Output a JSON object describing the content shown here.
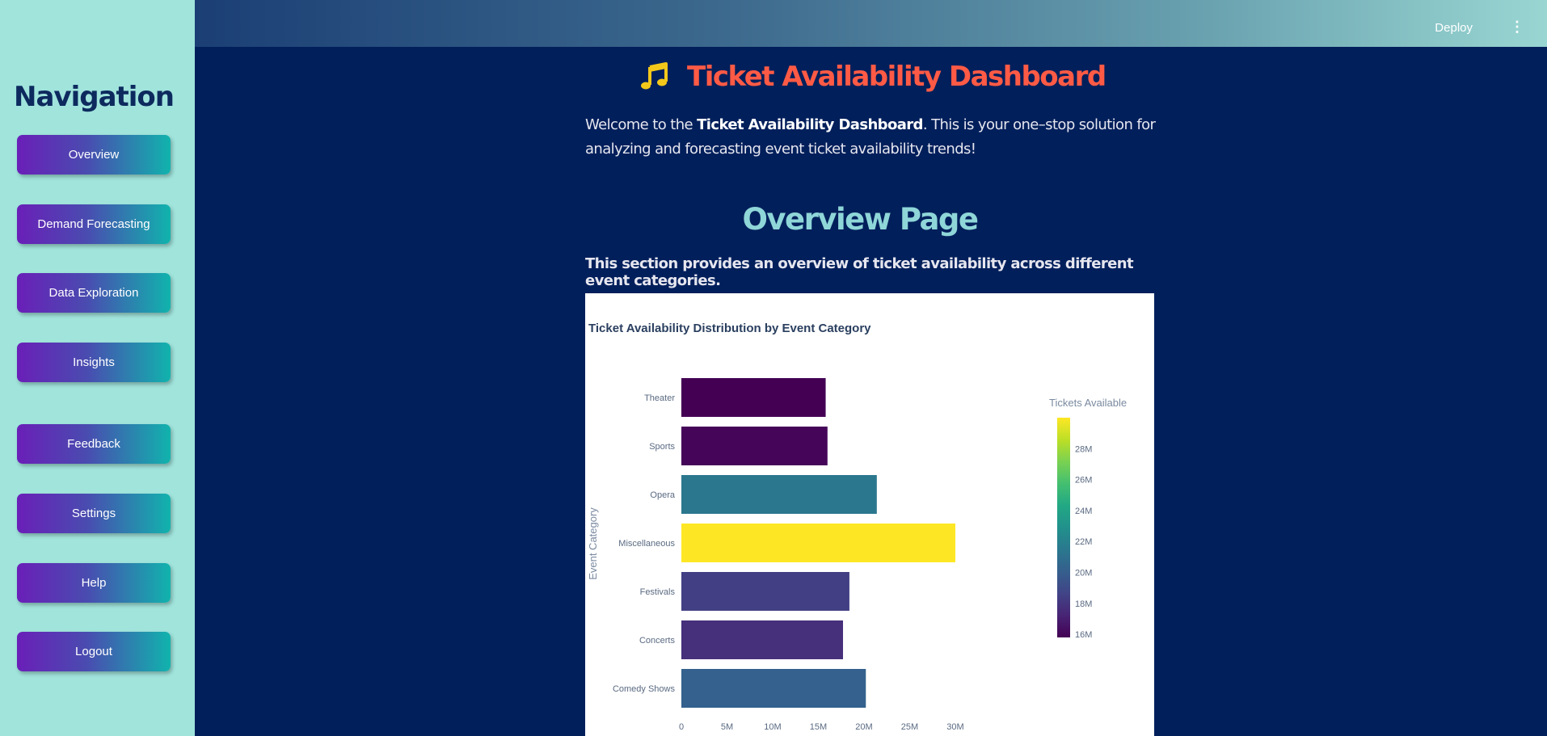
{
  "sidebar": {
    "title": "Navigation",
    "items": [
      {
        "label": "Overview",
        "name": "overview"
      },
      {
        "label": "Demand Forecasting",
        "name": "demand-forecasting"
      },
      {
        "label": "Data Exploration",
        "name": "data-exploration"
      },
      {
        "label": "Insights",
        "name": "insights"
      },
      {
        "label": "Feedback",
        "name": "feedback"
      },
      {
        "label": "Settings",
        "name": "settings"
      },
      {
        "label": "Help",
        "name": "help"
      },
      {
        "label": "Logout",
        "name": "logout"
      }
    ]
  },
  "header": {
    "deploy_label": "Deploy",
    "menu_icon": "kebab-menu-icon"
  },
  "main": {
    "title_icon": "music-note-icon",
    "title": "Ticket Availability Dashboard",
    "welcome_prefix": "Welcome to the ",
    "welcome_bold": "Ticket Availability Dashboard",
    "welcome_suffix": ". This is your one–stop solution for analyzing and forecasting event ticket availability trends!",
    "page_heading": "Overview Page",
    "section_description": "This section provides an overview of ticket availability across different event categories."
  },
  "colors": {
    "title": "#ff5a45",
    "heading": "#8fd6d8",
    "background": "#011f5b",
    "sidebar": "#a0e4dc"
  },
  "chart_data": {
    "type": "bar",
    "orientation": "horizontal",
    "title": "Ticket Availability Distribution by Event Category",
    "ylabel": "Event Category",
    "xlabel": "",
    "categories": [
      "Comedy Shows",
      "Concerts",
      "Festivals",
      "Miscellaneous",
      "Opera",
      "Sports",
      "Theater"
    ],
    "values": [
      20200000,
      17700000,
      18400000,
      30000000,
      21400000,
      16000000,
      15800000
    ],
    "xlim": [
      0,
      31500000
    ],
    "x_ticks": [
      "0",
      "5M",
      "10M",
      "15M",
      "20M",
      "25M",
      "30M"
    ],
    "x_tick_values": [
      0,
      5000000,
      10000000,
      15000000,
      20000000,
      25000000,
      30000000
    ],
    "colorbar": {
      "title": "Tickets Available",
      "min": 15800000,
      "max": 30000000,
      "ticks": [
        "16M",
        "18M",
        "20M",
        "22M",
        "24M",
        "26M",
        "28M"
      ],
      "tick_values": [
        16000000,
        18000000,
        20000000,
        22000000,
        24000000,
        26000000,
        28000000
      ],
      "colorscale": "viridis"
    },
    "grid": false,
    "legend": "right"
  }
}
